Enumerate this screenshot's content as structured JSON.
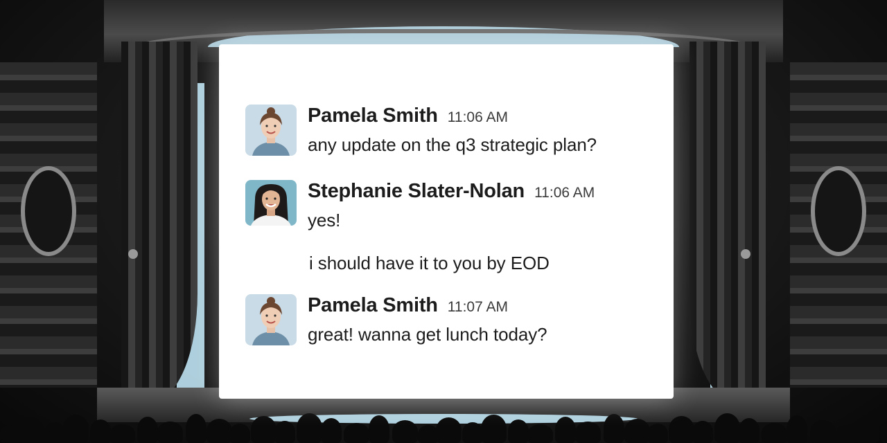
{
  "colors": {
    "screen": "#ffffff",
    "glow": "#bfe3f3",
    "text": "#1d1c1d",
    "timestamp": "#3a3a3a"
  },
  "messages": [
    {
      "name": "Pamela Smith",
      "time": "11:06 AM",
      "avatar": "avatar-pamela-smith",
      "lines": [
        "any update on the q3 strategic plan?"
      ]
    },
    {
      "name": "Stephanie Slater-Nolan",
      "time": "11:06 AM",
      "avatar": "avatar-stephanie-slater-nolan",
      "lines": [
        "yes!",
        "i should have it to you by EOD"
      ]
    },
    {
      "name": "Pamela Smith",
      "time": "11:07 AM",
      "avatar": "avatar-pamela-smith",
      "lines": [
        "great! wanna get lunch today?"
      ]
    }
  ]
}
